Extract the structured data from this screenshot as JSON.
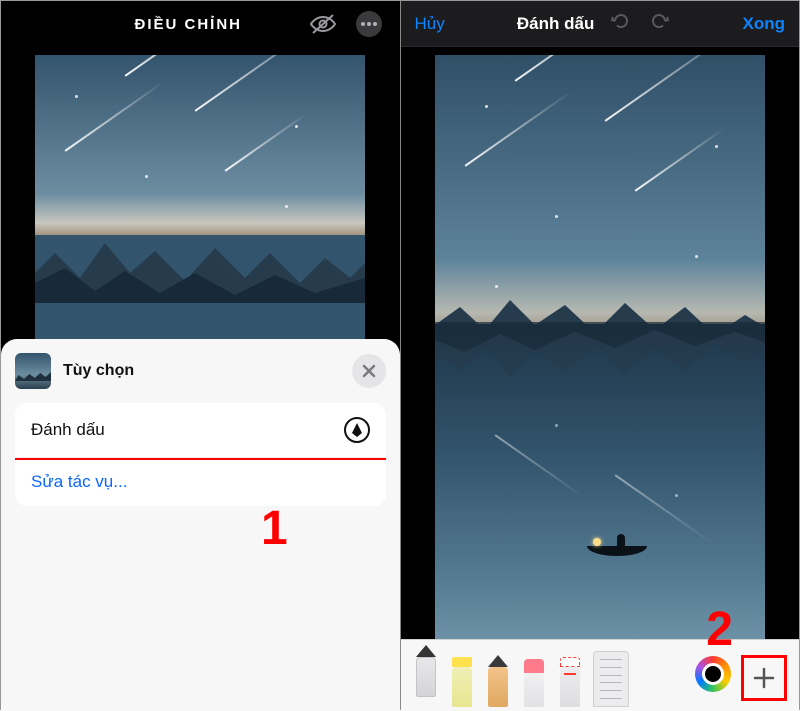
{
  "left": {
    "header_title": "ĐIỀU CHỈNH",
    "sheet": {
      "title": "Tùy chọn",
      "option_markup": "Đánh dấu",
      "option_edit_actions": "Sửa tác vụ..."
    }
  },
  "right": {
    "header": {
      "cancel": "Hủy",
      "title": "Đánh dấu",
      "done": "Xong"
    },
    "tools": {
      "pen": "pen",
      "highlighter": "highlighter",
      "pencil": "pencil",
      "eraser": "eraser",
      "lasso": "lasso",
      "ruler": "ruler",
      "color": "color-picker",
      "add": "add"
    }
  },
  "annotations": {
    "step1": "1",
    "step2": "2"
  },
  "colors": {
    "accent_blue": "#0a84ff",
    "highlight_red": "#ff0000"
  }
}
